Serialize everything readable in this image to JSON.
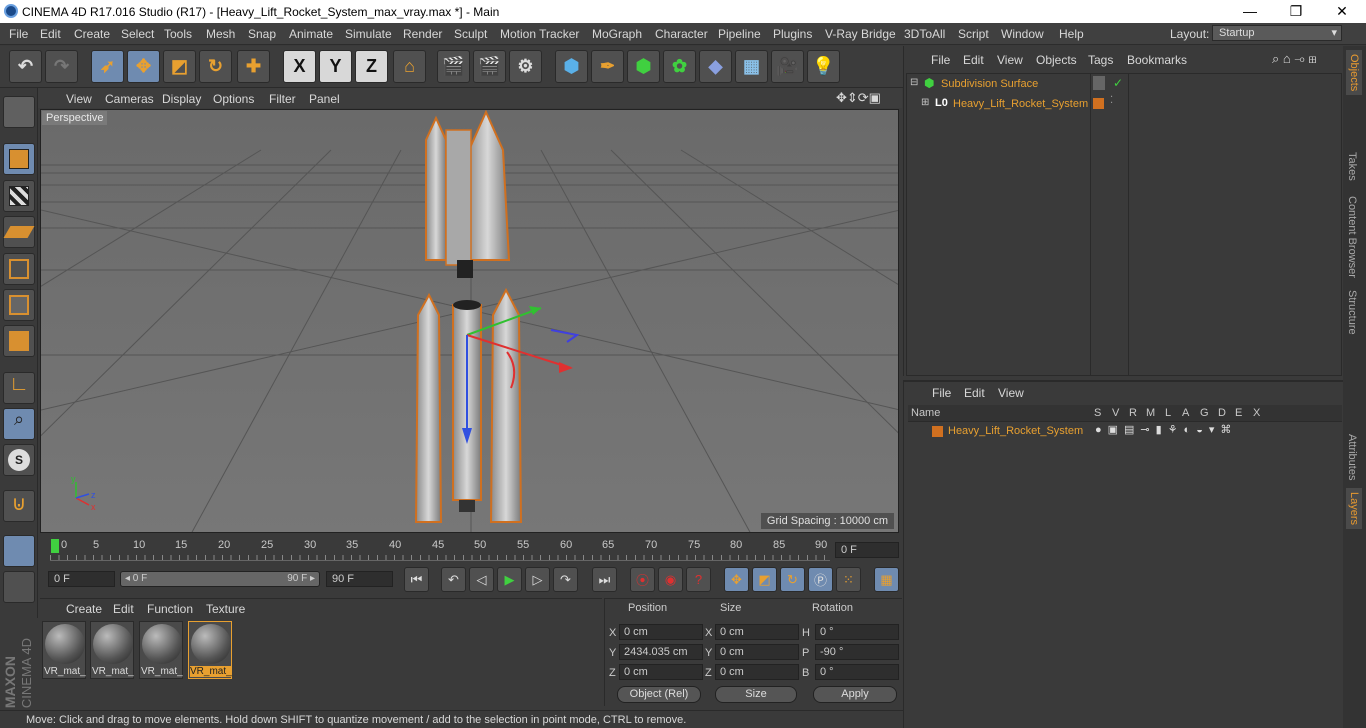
{
  "title": "CINEMA 4D R17.016 Studio (R17) - [Heavy_Lift_Rocket_System_max_vray.max *] - Main",
  "window_controls": [
    "—",
    "❐",
    "✕"
  ],
  "menu": [
    "File",
    "Edit",
    "Create",
    "Select",
    "Tools",
    "Mesh",
    "Snap",
    "Animate",
    "Simulate",
    "Render",
    "Sculpt",
    "Motion Tracker",
    "MoGraph",
    "Character",
    "Pipeline",
    "Plugins",
    "V-Ray Bridge",
    "3DToAll",
    "Script",
    "Window",
    "Help"
  ],
  "layout": {
    "label": "Layout:",
    "value": "Startup"
  },
  "toolbar": {
    "x": "X",
    "y": "Y",
    "z": "Z"
  },
  "viewport": {
    "menu": [
      "View",
      "Cameras",
      "Display",
      "Options",
      "Filter",
      "Panel"
    ],
    "label": "Perspective",
    "grid_spacing": "Grid Spacing : 10000 cm",
    "axis": {
      "x": "x",
      "y": "y",
      "z": "z"
    }
  },
  "timeline": {
    "ticks": [
      "0",
      "5",
      "10",
      "15",
      "20",
      "25",
      "30",
      "35",
      "40",
      "45",
      "50",
      "55",
      "60",
      "65",
      "70",
      "75",
      "80",
      "85",
      "90"
    ],
    "current": "0 F",
    "start": "0 F",
    "slider_left": "◂ 0 F",
    "slider_right": "90 F ▸",
    "end": "90 F"
  },
  "materials": {
    "menu": [
      "Create",
      "Edit",
      "Function",
      "Texture"
    ],
    "items": [
      "VR_mat_",
      "VR_mat_",
      "VR_mat_",
      "VR_mat_"
    ]
  },
  "coords": {
    "headers": [
      "Position",
      "Size",
      "Rotation"
    ],
    "rows": [
      {
        "a": "X",
        "pos": "0 cm",
        "b": "X",
        "size": "0 cm",
        "c": "H",
        "rot": "0 °"
      },
      {
        "a": "Y",
        "pos": "2434.035 cm",
        "b": "Y",
        "size": "0 cm",
        "c": "P",
        "rot": "-90 °"
      },
      {
        "a": "Z",
        "pos": "0 cm",
        "b": "Z",
        "size": "0 cm",
        "c": "B",
        "rot": "0 °"
      }
    ],
    "mode": "Object (Rel)",
    "size_mode": "Size",
    "apply": "Apply"
  },
  "status": "Move: Click and drag to move elements. Hold down SHIFT to quantize movement / add to the selection in point mode, CTRL to remove.",
  "objects_panel": {
    "menu": [
      "File",
      "Edit",
      "View",
      "Objects",
      "Tags",
      "Bookmarks"
    ],
    "items": [
      "Subdivision Surface",
      "Heavy_Lift_Rocket_System"
    ]
  },
  "layers_panel": {
    "menu": [
      "File",
      "Edit",
      "View"
    ],
    "headers": [
      "Name",
      "S",
      "V",
      "R",
      "M",
      "L",
      "A",
      "G",
      "D",
      "E",
      "X"
    ],
    "items": [
      "Heavy_Lift_Rocket_System"
    ]
  },
  "right_tabs": [
    "Objects",
    "Takes",
    "Content Browser",
    "Structure",
    "Attributes",
    "Layers"
  ],
  "logo": {
    "line1": "MAXON",
    "line2": "CINEMA 4D"
  },
  "colors": {
    "accent": "#6f8bb0",
    "highlight": "#e8a030",
    "object": "#d07020"
  }
}
